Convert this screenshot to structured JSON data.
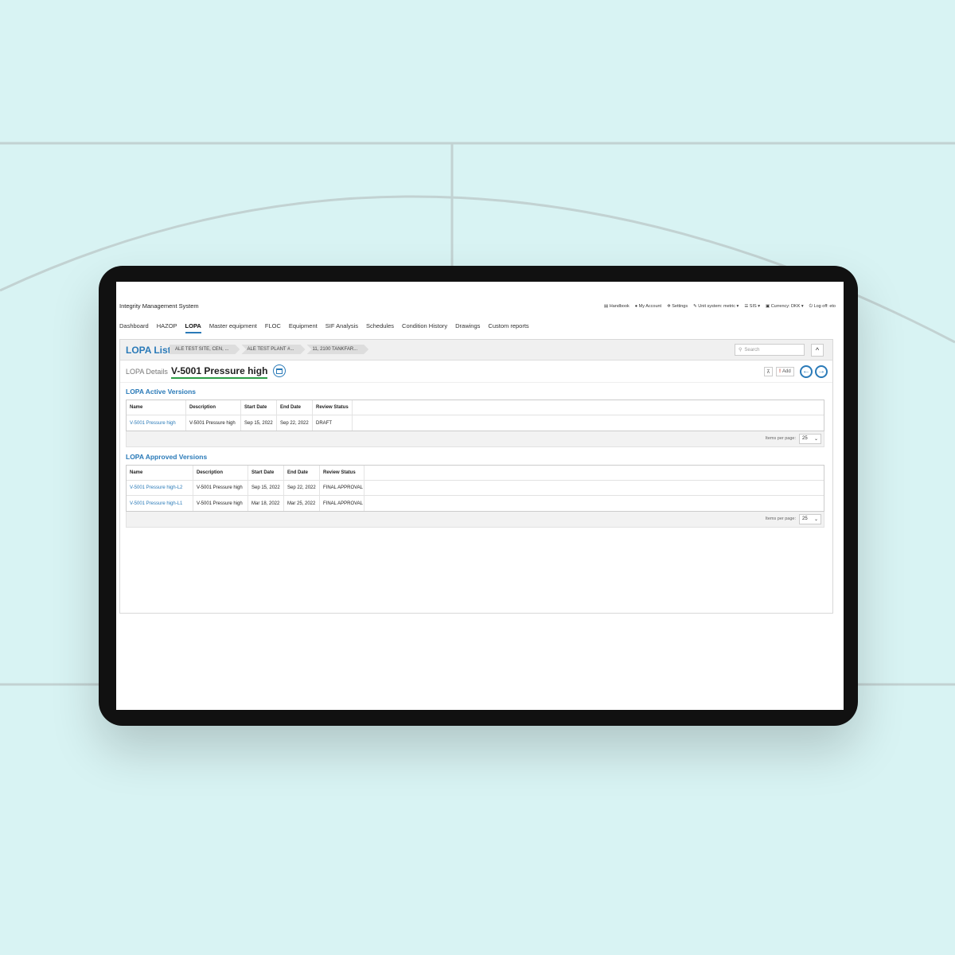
{
  "app": {
    "title": "Integrity Management System"
  },
  "top_links": [
    {
      "icon": "book-icon",
      "label": "Handbook"
    },
    {
      "icon": "user-icon",
      "label": "My Account"
    },
    {
      "icon": "gear-icon",
      "label": "Settings"
    },
    {
      "icon": "wrench-icon",
      "label": "Unit system: metric"
    },
    {
      "icon": "list-icon",
      "label": "SIS"
    },
    {
      "icon": "currency-icon",
      "label": "Currency: DKK"
    },
    {
      "icon": "power-icon",
      "label": "Log off: eto"
    }
  ],
  "nav": [
    "Dashboard",
    "HAZOP",
    "LOPA",
    "Master equipment",
    "FLOC",
    "Equipment",
    "SIF Analysis",
    "Schedules",
    "Condition History",
    "Drawings",
    "Custom reports"
  ],
  "nav_active": "LOPA",
  "list": {
    "title": "LOPA List",
    "crumbs": [
      "ALE TEST SITE, CEN, ...",
      "ALE TEST PLANT #...",
      "11, 2100 TANKFAR..."
    ],
    "search_placeholder": "Search",
    "collapse_glyph": "^"
  },
  "details": {
    "label": "LOPA Details",
    "name": "V-5001 Pressure high",
    "add_label": "Add",
    "add_mark": "!",
    "pin_glyph": "⊼",
    "prev_glyph": "←",
    "next_glyph": "→"
  },
  "active": {
    "title": "LOPA Active Versions",
    "columns": [
      "Name",
      "Description",
      "Start Date",
      "End Date",
      "Review Status"
    ],
    "rows": [
      [
        "V-5001 Pressure high",
        "V-5001 Pressure high",
        "Sep 15, 2022",
        "Sep 22, 2022",
        "DRAFT"
      ]
    ],
    "items_per_page_label": "Items per page:",
    "items_per_page": "25"
  },
  "approved": {
    "title": "LOPA Approved Versions",
    "columns": [
      "Name",
      "Description",
      "Start Date",
      "End Date",
      "Review Status"
    ],
    "rows": [
      [
        "V-5001 Pressure high-L2",
        "V-5001 Pressure high",
        "Sep 15, 2022",
        "Sep 22, 2022",
        "FINAL APPROVAL"
      ],
      [
        "V-5001 Pressure high-L1",
        "V-5001 Pressure high",
        "Mar 18, 2022",
        "Mar 25, 2022",
        "FINAL APPROVAL"
      ]
    ],
    "items_per_page_label": "Items per page:",
    "items_per_page": "25"
  },
  "colors": {
    "accent": "#2a7ab8",
    "underline": "#2d9d47",
    "background": "#d8f3f3"
  }
}
